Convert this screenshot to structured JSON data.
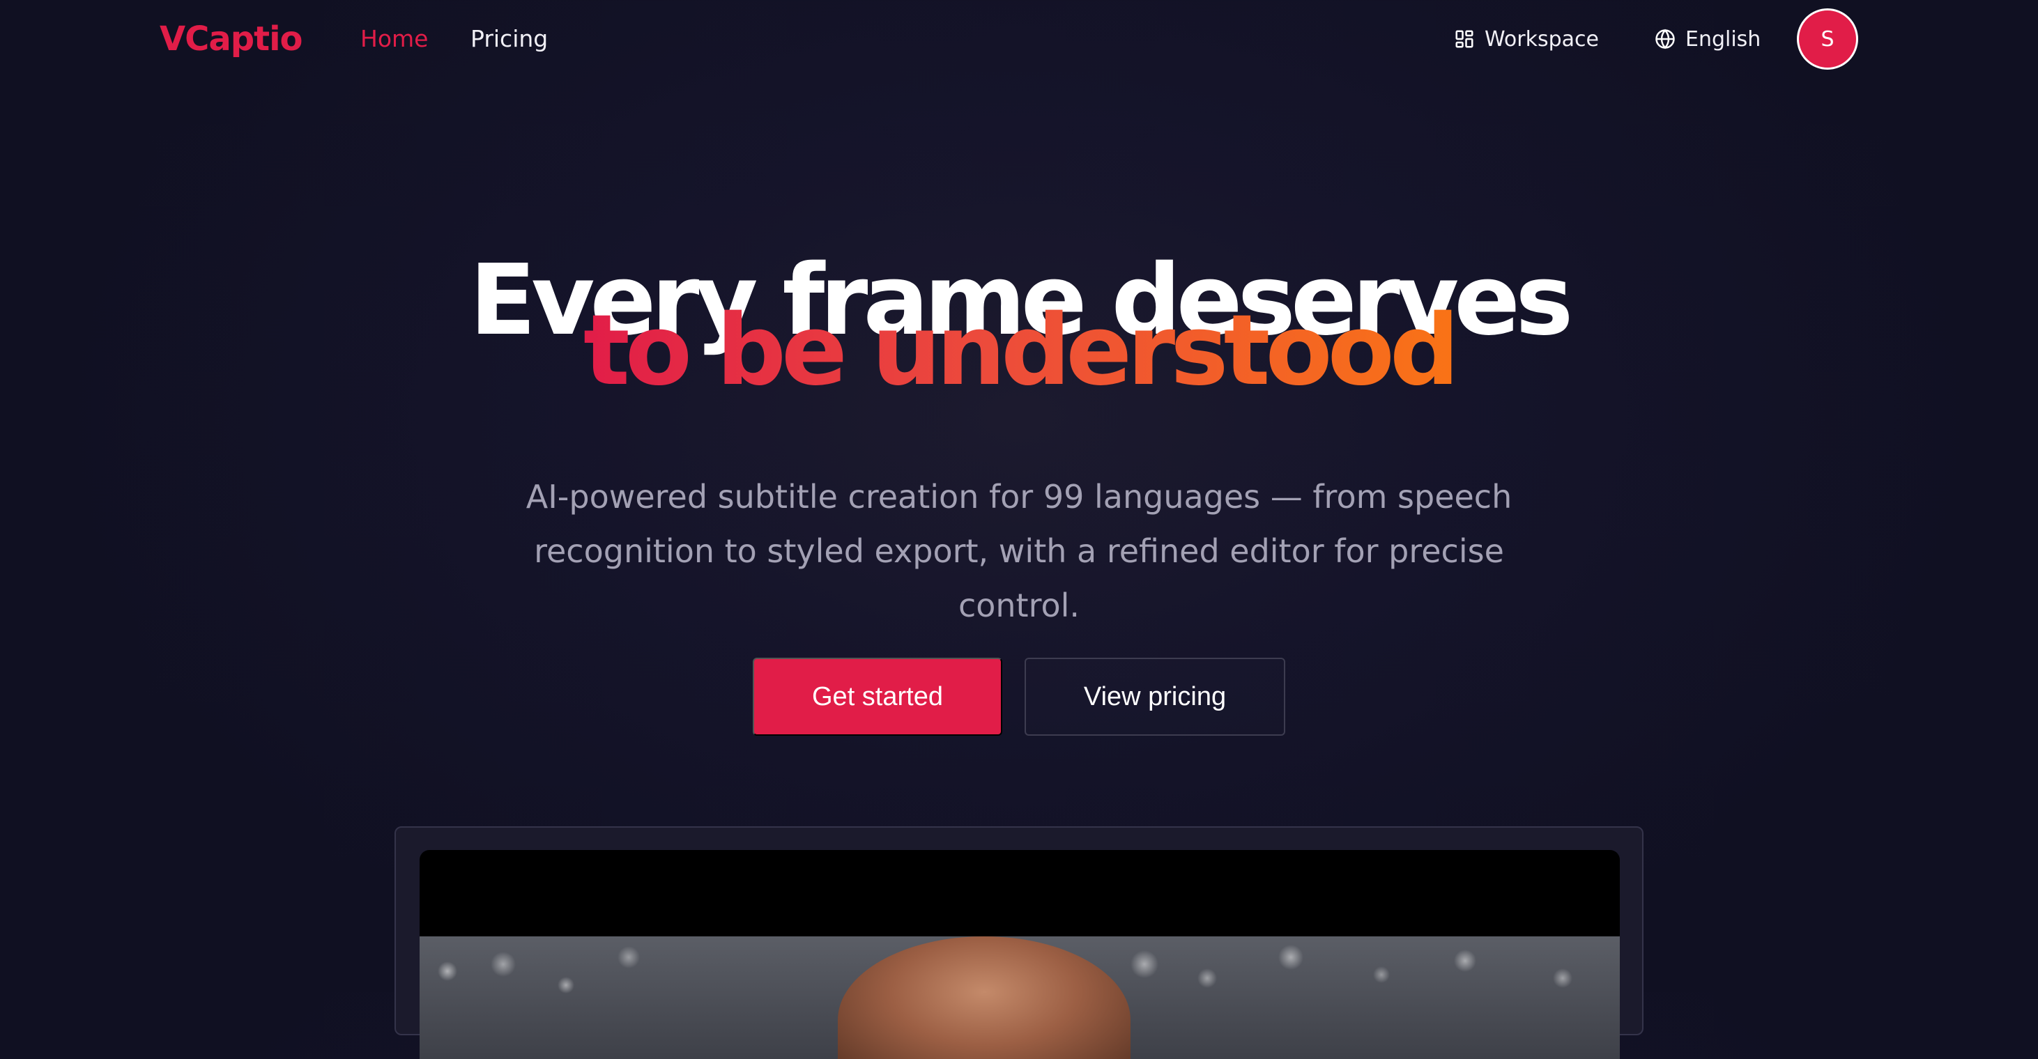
{
  "brand": {
    "name": "VCaptio"
  },
  "nav": {
    "links": [
      {
        "label": "Home",
        "active": true
      },
      {
        "label": "Pricing",
        "active": false
      }
    ],
    "workspace_label": "Workspace",
    "workspace_icon": "grid-icon",
    "language_label": "English",
    "language_icon": "globe-icon",
    "avatar_initial": "S"
  },
  "hero": {
    "headline_line1": "Every frame deserves",
    "headline_line2": "to be understood",
    "subtitle": "AI-powered subtitle creation for 99 languages — from speech recognition to styled export, with a refined editor for precise control.",
    "primary_cta": "Get started",
    "secondary_cta": "View pricing"
  },
  "colors": {
    "background": "#13122a",
    "accent": "#e11d48",
    "gradient_start": "#e11d48",
    "gradient_end": "#f97316",
    "muted_text": "#a3a1b4",
    "border": "#3d3c50"
  }
}
